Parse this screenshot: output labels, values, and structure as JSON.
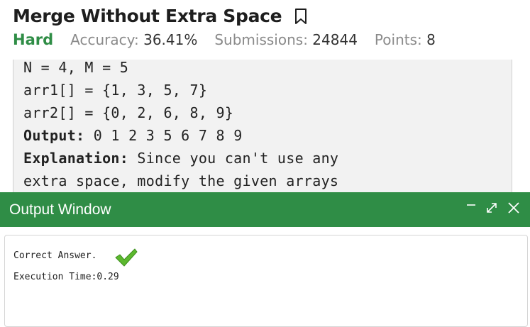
{
  "problem": {
    "title": "Merge Without Extra Space",
    "difficulty": "Hard",
    "accuracy_label": "Accuracy:",
    "accuracy_value": "36.41%",
    "submissions_label": "Submissions:",
    "submissions_value": "24844",
    "points_label": "Points:",
    "points_value": "8"
  },
  "example": {
    "line1": "N = 4, M = 5",
    "line2": "arr1[] = {1, 3, 5, 7}",
    "line3": "arr2[] = {0, 2, 6, 8, 9}",
    "output_label": "Output:",
    "output_value": " 0 1 2 3 5 6 7 8 9",
    "explanation_label": "Explanation:",
    "explanation_line1": " Since you can't use any",
    "explanation_line2": "extra space, modify the given arrays"
  },
  "output_window": {
    "title": "Output Window",
    "result": "Correct Answer.",
    "execution_time": "Execution Time:0.29"
  },
  "icons": {
    "bookmark": "bookmark-icon",
    "minimize": "minimize-icon",
    "expand": "expand-icon",
    "close": "close-icon",
    "check": "checkmark-icon"
  },
  "colors": {
    "accent_green": "#2f8d46",
    "check_green": "#5cb82e"
  }
}
